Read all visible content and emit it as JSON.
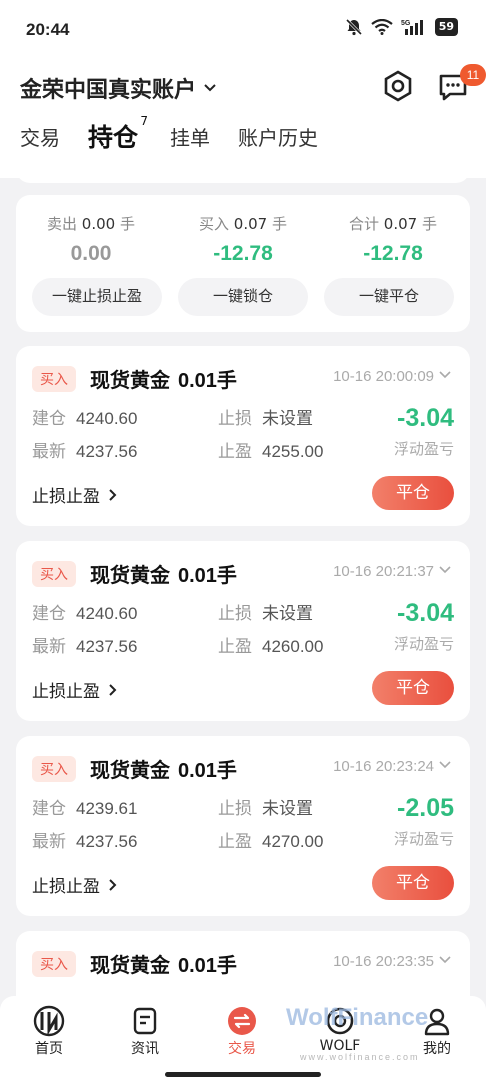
{
  "status_bar": {
    "time": "20:44",
    "battery": "59"
  },
  "header": {
    "account_name": "金荣中国真实账户",
    "notification_count": "11"
  },
  "tabs": [
    {
      "label": "交易"
    },
    {
      "label": "持仓",
      "count": "7"
    },
    {
      "label": "挂单"
    },
    {
      "label": "账户历史"
    }
  ],
  "summary": {
    "sell": {
      "label": "卖出",
      "lots": "0.00",
      "unit": "手",
      "value": "0.00"
    },
    "buy": {
      "label": "买入",
      "lots": "0.07",
      "unit": "手",
      "value": "-12.78"
    },
    "total": {
      "label": "合计",
      "lots": "0.07",
      "unit": "手",
      "value": "-12.78"
    },
    "buttons": {
      "sltp": "一键止损止盈",
      "lock": "一键锁仓",
      "close_all": "一键平仓"
    }
  },
  "positions": [
    {
      "side": "买入",
      "symbol": "现货黄金",
      "lots": "0.01手",
      "time": "10-16 20:00:09",
      "open_label": "建仓",
      "open": "4240.60",
      "last_label": "最新",
      "last": "4237.56",
      "sl_label": "止损",
      "sl": "未设置",
      "tp_label": "止盈",
      "tp": "4255.00",
      "pnl": "-3.04",
      "pnl_label": "浮动盈亏",
      "sltp_link": "止损止盈",
      "close_label": "平仓"
    },
    {
      "side": "买入",
      "symbol": "现货黄金",
      "lots": "0.01手",
      "time": "10-16 20:21:37",
      "open_label": "建仓",
      "open": "4240.60",
      "last_label": "最新",
      "last": "4237.56",
      "sl_label": "止损",
      "sl": "未设置",
      "tp_label": "止盈",
      "tp": "4260.00",
      "pnl": "-3.04",
      "pnl_label": "浮动盈亏",
      "sltp_link": "止损止盈",
      "close_label": "平仓"
    },
    {
      "side": "买入",
      "symbol": "现货黄金",
      "lots": "0.01手",
      "time": "10-16 20:23:24",
      "open_label": "建仓",
      "open": "4239.61",
      "last_label": "最新",
      "last": "4237.56",
      "sl_label": "止损",
      "sl": "未设置",
      "tp_label": "止盈",
      "tp": "4270.00",
      "pnl": "-2.05",
      "pnl_label": "浮动盈亏",
      "sltp_link": "止损止盈",
      "close_label": "平仓"
    },
    {
      "side": "买入",
      "symbol": "现货黄金",
      "lots": "0.01手",
      "time": "10-16 20:23:35"
    }
  ],
  "bottom_nav": [
    {
      "label": "首页"
    },
    {
      "label": "资讯"
    },
    {
      "label": "交易",
      "active": true
    },
    {
      "label": "WOLF"
    },
    {
      "label": "我的"
    }
  ],
  "watermark": {
    "brand": "WolfFinance",
    "url": "www.wolfinance.com"
  },
  "colors": {
    "accent": "#e9584a",
    "gain": "#2fbc7f",
    "background": "#f2f2f4"
  }
}
